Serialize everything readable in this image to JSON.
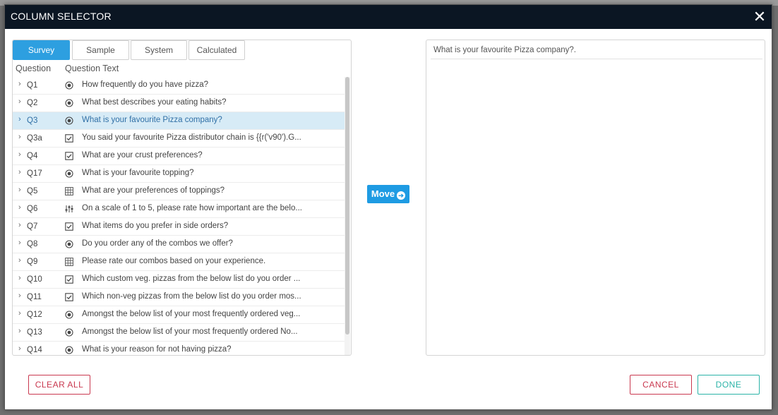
{
  "dialog": {
    "title": "COLUMN SELECTOR",
    "close_glyph": "✕"
  },
  "tabs": [
    {
      "label": "Survey",
      "active": true
    },
    {
      "label": "Sample",
      "active": false
    },
    {
      "label": "System",
      "active": false
    },
    {
      "label": "Calculated",
      "active": false
    }
  ],
  "columns": {
    "question": "Question",
    "question_text": "Question Text"
  },
  "questions": [
    {
      "id": "Q1",
      "icon": "radio-icon",
      "text": "How frequently do you have pizza?"
    },
    {
      "id": "Q2",
      "icon": "radio-icon",
      "text": "What best describes your eating habits?"
    },
    {
      "id": "Q3",
      "icon": "radio-icon",
      "text": "What is your favourite Pizza company?",
      "selected": true
    },
    {
      "id": "Q3a",
      "icon": "checkbox-icon",
      "text": "You said your favourite Pizza distributor chain is {{r('v90').G..."
    },
    {
      "id": "Q4",
      "icon": "checkbox-icon",
      "text": "What are your crust preferences?"
    },
    {
      "id": "Q17",
      "icon": "radio-icon",
      "text": "What is your favourite topping?"
    },
    {
      "id": "Q5",
      "icon": "grid-icon",
      "text": "What are your preferences of toppings?"
    },
    {
      "id": "Q6",
      "icon": "sliders-icon",
      "text": "On a scale of 1 to 5, please rate how important are the belo..."
    },
    {
      "id": "Q7",
      "icon": "checkbox-icon",
      "text": "What items do you prefer in side orders?"
    },
    {
      "id": "Q8",
      "icon": "radio-icon",
      "text": "Do you order any of the combos we offer?"
    },
    {
      "id": "Q9",
      "icon": "grid-icon",
      "text": "Please rate our combos based on your experience."
    },
    {
      "id": "Q10",
      "icon": "checkbox-icon",
      "text": "Which custom veg. pizzas from the below list do you order ..."
    },
    {
      "id": "Q11",
      "icon": "checkbox-icon",
      "text": "Which non-veg pizzas from the below list do you order mos..."
    },
    {
      "id": "Q12",
      "icon": "radio-icon",
      "text": "Amongst the below list of your most frequently ordered veg..."
    },
    {
      "id": "Q13",
      "icon": "radio-icon",
      "text": "Amongst the below list of your most frequently ordered No..."
    },
    {
      "id": "Q14",
      "icon": "radio-icon",
      "text": "What is your reason for not having pizza?"
    }
  ],
  "move_button": {
    "label": "Move"
  },
  "selected_columns": [
    "What is your favourite Pizza company?."
  ],
  "footer": {
    "clear_all": "CLEAR ALL",
    "cancel": "CANCEL",
    "done": "DONE"
  },
  "colors": {
    "accent": "#2d9fe0",
    "header_bg": "#0b1623",
    "danger": "#c9384f",
    "success": "#2bb3a7",
    "selected_row": "#d7ebf6"
  }
}
